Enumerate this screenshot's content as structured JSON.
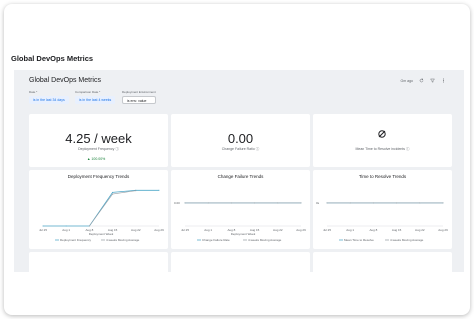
{
  "page": {
    "title": "Global DevOps Metrics"
  },
  "dashboard": {
    "title": "Global DevOps Metrics",
    "refresh_label": "Gm ago",
    "filters": [
      {
        "label": "Date *",
        "value": "is in the last 34 days",
        "style": "accent"
      },
      {
        "label": "Comparison Date *",
        "value": "is in the last 4 weeks",
        "style": "accent"
      },
      {
        "label": "Deployment Environment",
        "value": "is env: value",
        "style": "plain"
      }
    ]
  },
  "kpis": [
    {
      "value": "4.25 / week",
      "label": "Deployment Frequency",
      "delta": "▲ 100.00%"
    },
    {
      "value": "0.00",
      "label": "Change Failure Ratio",
      "delta": ""
    },
    {
      "value": "",
      "icon": "empty-set-icon",
      "label": "Mean Time to Resolve incidents",
      "delta": ""
    }
  ],
  "charts": [
    {
      "title": "Deployment Frequency Trends",
      "legend": [
        "Deployment Frequency",
        "4 weeks Moving Average"
      ]
    },
    {
      "title": "Change Failure Trends",
      "legend": [
        "Change Failure Rate",
        "4 weeks Moving Average"
      ]
    },
    {
      "title": "Time to Resolve Trends",
      "legend": [
        "Mean Time to Resolve",
        "4 weeks Moving Average"
      ]
    }
  ],
  "chart_data": [
    {
      "type": "line",
      "title": "Deployment Frequency Trends",
      "categories": [
        "Jul 25",
        "Aug 1",
        "Aug 8",
        "Aug 15",
        "Aug 22",
        "Aug 29"
      ],
      "x_axis_title": "Deployment Week",
      "series": [
        {
          "name": "Deployment Frequency",
          "values": [
            0,
            0,
            0,
            4,
            4.25,
            4.25
          ],
          "color": "#4fa8c9"
        },
        {
          "name": "4 weeks Moving Average",
          "values": [
            null,
            null,
            0,
            3.8,
            4.2,
            null
          ],
          "color": "#9aa0a6"
        }
      ],
      "ylim": [
        0,
        5
      ]
    },
    {
      "type": "line",
      "title": "Change Failure Trends",
      "categories": [
        "Jul 25",
        "Aug 1",
        "Aug 8",
        "Aug 15",
        "Aug 22",
        "Aug 29"
      ],
      "x_axis_title": "Deployment Week",
      "y_tick": "0.00",
      "series": [
        {
          "name": "Change Failure Rate",
          "values": [
            0,
            0,
            0,
            0,
            0,
            0
          ],
          "color": "#4fa8c9"
        },
        {
          "name": "4 weeks Moving Average",
          "values": [
            0,
            0,
            0,
            0,
            0,
            0
          ],
          "color": "#9aa0a6"
        }
      ]
    },
    {
      "type": "line",
      "title": "Time to Resolve Trends",
      "categories": [
        "Jul 25",
        "Aug 1",
        "Aug 8",
        "Aug 15",
        "Aug 22",
        "Aug 29"
      ],
      "y_tick": "0s",
      "series": [
        {
          "name": "Mean Time to Resolve",
          "values": [
            0,
            0,
            0,
            0,
            0,
            0
          ],
          "color": "#4fa8c9"
        },
        {
          "name": "4 weeks Moving Average",
          "values": [
            0,
            0,
            0,
            0,
            0,
            0
          ],
          "color": "#9aa0a6"
        }
      ]
    }
  ]
}
